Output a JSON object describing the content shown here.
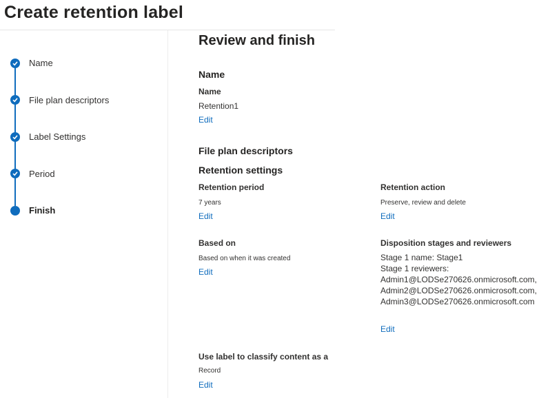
{
  "page_title": "Create retention label",
  "steps": [
    {
      "label": "Name",
      "status": "done"
    },
    {
      "label": "File plan descriptors",
      "status": "done"
    },
    {
      "label": "Label Settings",
      "status": "done"
    },
    {
      "label": "Period",
      "status": "done"
    },
    {
      "label": "Finish",
      "status": "current"
    }
  ],
  "accent_color": "#0f6cbd",
  "review": {
    "heading": "Review and finish",
    "name_section": {
      "heading": "Name",
      "field_label": "Name",
      "value": "Retention1",
      "edit": "Edit"
    },
    "file_plan_heading": "File plan descriptors",
    "retention_settings": {
      "heading": "Retention settings",
      "retention_period": {
        "label": "Retention period",
        "value": "7 years",
        "edit": "Edit"
      },
      "retention_action": {
        "label": "Retention action",
        "value": "Preserve, review and delete",
        "edit": "Edit"
      },
      "based_on": {
        "label": "Based on",
        "value": "Based on when it was created",
        "edit": "Edit"
      },
      "disposition": {
        "label": "Disposition stages and reviewers",
        "stage_name": "Stage 1 name: Stage1",
        "reviewers_label": "Stage 1 reviewers:",
        "reviewers": [
          "Admin1@LODSe270626.onmicrosoft.com,",
          "Admin2@LODSe270626.onmicrosoft.com,",
          "Admin3@LODSe270626.onmicrosoft.com"
        ],
        "edit": "Edit"
      }
    },
    "classify": {
      "label": "Use label to classify content as a",
      "value": "Record",
      "edit": "Edit"
    }
  }
}
